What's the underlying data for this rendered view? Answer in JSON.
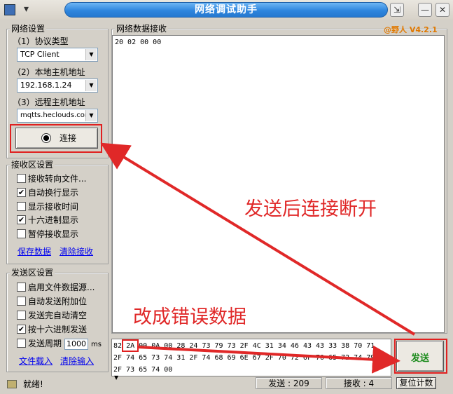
{
  "window": {
    "title": "网络调试助手",
    "menu_glyph": "▾",
    "pin_glyph": "⇲",
    "minimize_glyph": "—",
    "close_glyph": "✕"
  },
  "settings": {
    "group_title": "网络设置",
    "protocol_label": "（1）协议类型",
    "protocol_value": "TCP Client",
    "local_label": "（2）本地主机地址",
    "local_value": "192.168.1.24",
    "remote_label": "（3）远程主机地址",
    "remote_value": "mqtts.heclouds.com",
    "connect_label": "连接"
  },
  "receive_settings": {
    "group_title": "接收区设置",
    "options": [
      {
        "label": "接收转向文件...",
        "checked": false
      },
      {
        "label": "自动换行显示",
        "checked": true
      },
      {
        "label": "显示接收时间",
        "checked": false
      },
      {
        "label": "十六进制显示",
        "checked": true
      },
      {
        "label": "暂停接收显示",
        "checked": false
      }
    ],
    "save_link": "保存数据",
    "clear_link": "清除接收"
  },
  "send_settings": {
    "group_title": "发送区设置",
    "options": [
      {
        "label": "启用文件数据源...",
        "checked": false
      },
      {
        "label": "自动发送附加位",
        "checked": false
      },
      {
        "label": "发送完自动清空",
        "checked": false
      },
      {
        "label": "按十六进制发送",
        "checked": true
      },
      {
        "label": "发送周期",
        "checked": false
      }
    ],
    "period_value": "1000",
    "period_unit": "ms",
    "load_link": "文件载入",
    "clear_link": "清除输入"
  },
  "receive_area": {
    "title": "网络数据接收",
    "brand": "@野人 V4.2.1",
    "content": "20 02 00 00"
  },
  "send_area": {
    "line1_first": "82",
    "line1_highlight": "2A",
    "line1_rest": "00 0A 00 28 24 73 79 73 2F 4C 31 34 46 43 43 33 38 70 71",
    "line2": "2F 74 65 73 74 31 2F 74 68 69 6E 67 2F 70 72 6F 70 65 72 74 79",
    "line3": "2F 73 65 74 00",
    "send_button": "发送"
  },
  "annotations": {
    "disconnect_note": "发送后连接断开",
    "wrong_data_note": "改成错误数据"
  },
  "statusbar": {
    "status": "就绪!",
    "sent": "发送 : 209",
    "received": "接收 : 4",
    "reset": "复位计数"
  },
  "colors": {
    "annotation_red": "#e02828",
    "title_blue": "#2f86de",
    "brand_orange": "#e07800",
    "send_green": "#1a8a1a"
  }
}
